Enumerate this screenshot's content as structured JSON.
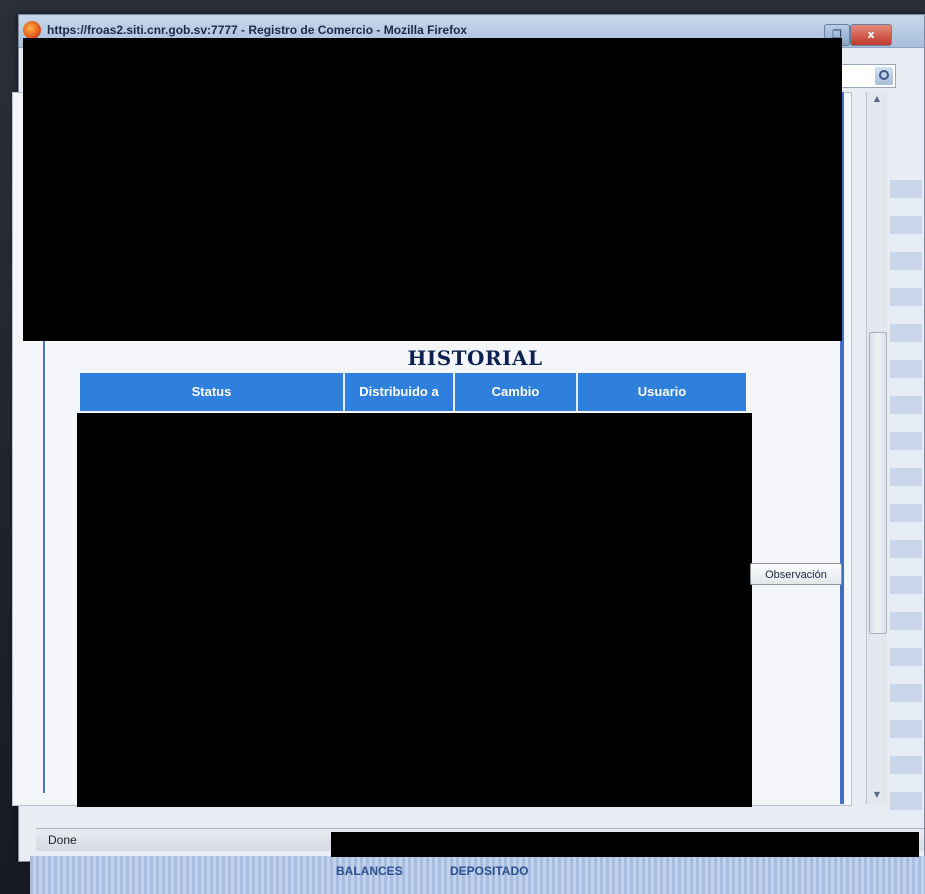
{
  "window": {
    "title_url": "https://froas2.siti.cnr.gob.sv:7777 - Registro de Comercio - Mozilla Firefox",
    "restore_glyph": "❐",
    "close_glyph": "x"
  },
  "historial": {
    "title": "HISTORIAL",
    "columns": [
      {
        "label": "Status"
      },
      {
        "label": "Distribuido a"
      },
      {
        "label": "Cambio"
      },
      {
        "label": "Usuario"
      }
    ]
  },
  "buttons": {
    "observacion_label": "Observación"
  },
  "statusbar": {
    "text": "Done"
  },
  "taskbar": {
    "items": [
      "BALANCES",
      "DEPOSITADO"
    ]
  },
  "icons": {
    "browser": "firefox-icon",
    "search": "search-icon",
    "scroll_up": "scroll-up-arrow-icon",
    "scroll_down": "scroll-down-arrow-icon"
  },
  "colors": {
    "table_header": "#2f7fdd",
    "title_text": "#0d2150"
  }
}
